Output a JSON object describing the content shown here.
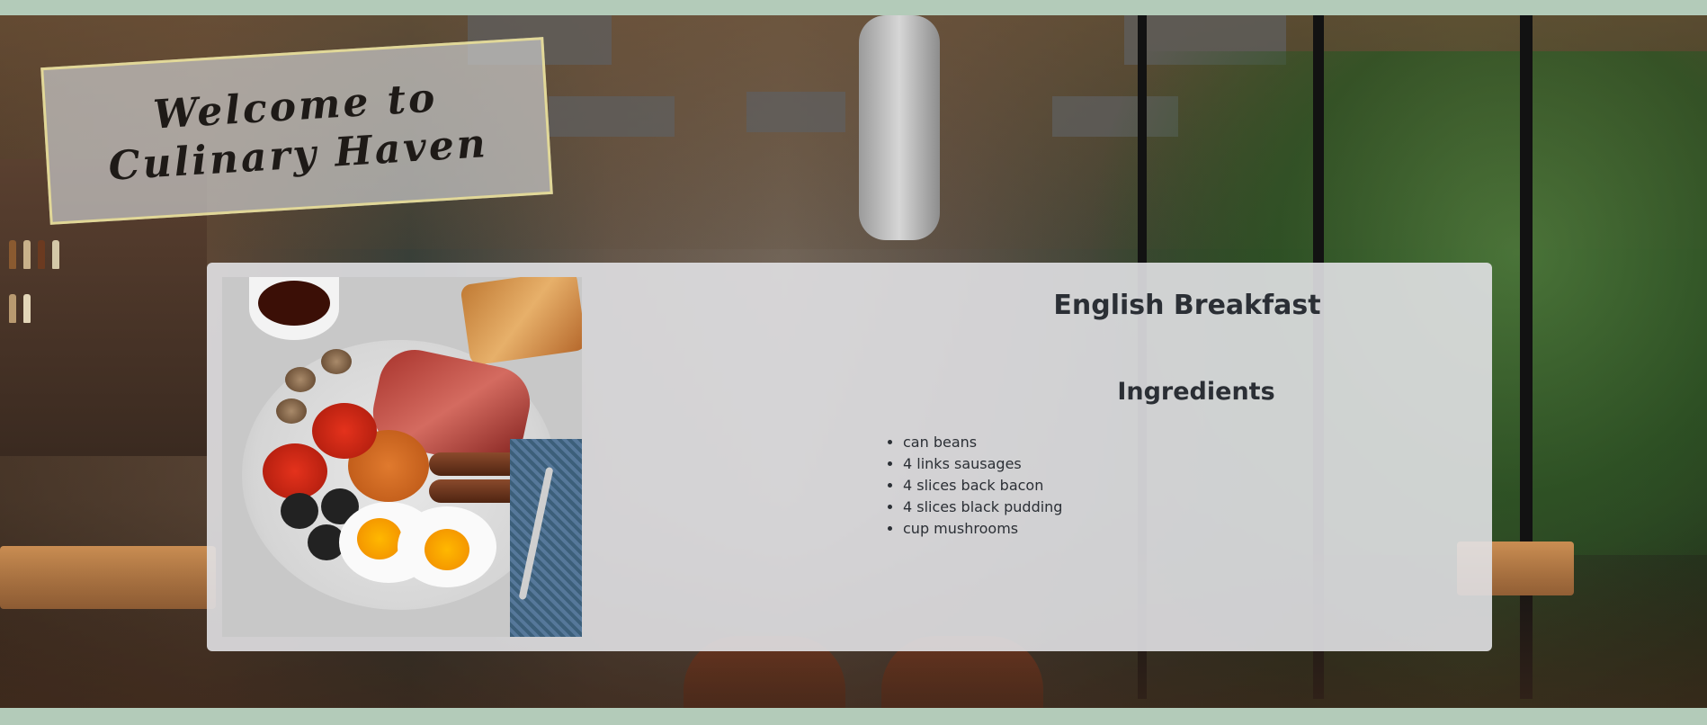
{
  "banner": {
    "title": "Welcome to Culinary Haven"
  },
  "recipe": {
    "title": "English Breakfast",
    "ingredients_heading": "Ingredients",
    "ingredients": [
      "can beans",
      "4 links sausages",
      "4 slices back bacon",
      "4 slices black pudding",
      "cup mushrooms"
    ]
  },
  "colors": {
    "page_background": "#b3cbb9",
    "card_background": "#e1e1e4",
    "banner_border": "#ebe196",
    "text": "#2b2f35"
  }
}
